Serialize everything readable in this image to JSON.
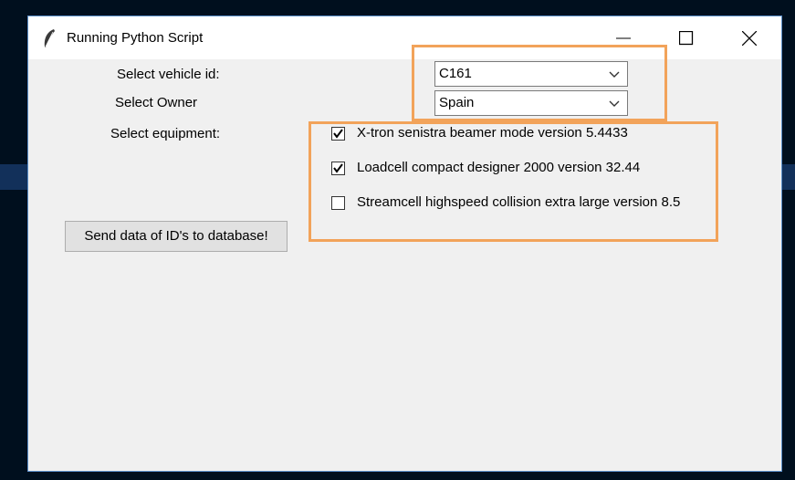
{
  "window": {
    "title": "Running Python Script",
    "controls": {
      "minimize_icon": "minimize-icon",
      "maximize_icon": "maximize-icon",
      "close_icon": "close-icon"
    }
  },
  "form": {
    "vehicle_label": "Select vehicle id:",
    "vehicle_value": "C161",
    "owner_label": "Select Owner",
    "owner_value": "Spain",
    "equipment_label": "Select equipment:",
    "equipment": [
      {
        "label": "X-tron senistra beamer mode version 5.4433",
        "checked": true
      },
      {
        "label": "Loadcell compact designer 2000 version 32.44",
        "checked": true
      },
      {
        "label": "Streamcell highspeed collision extra large version 8.5",
        "checked": false
      }
    ],
    "send_button": "Send data of ID's to database!"
  },
  "annotations": {
    "highlight_color": "#f2a35a"
  }
}
